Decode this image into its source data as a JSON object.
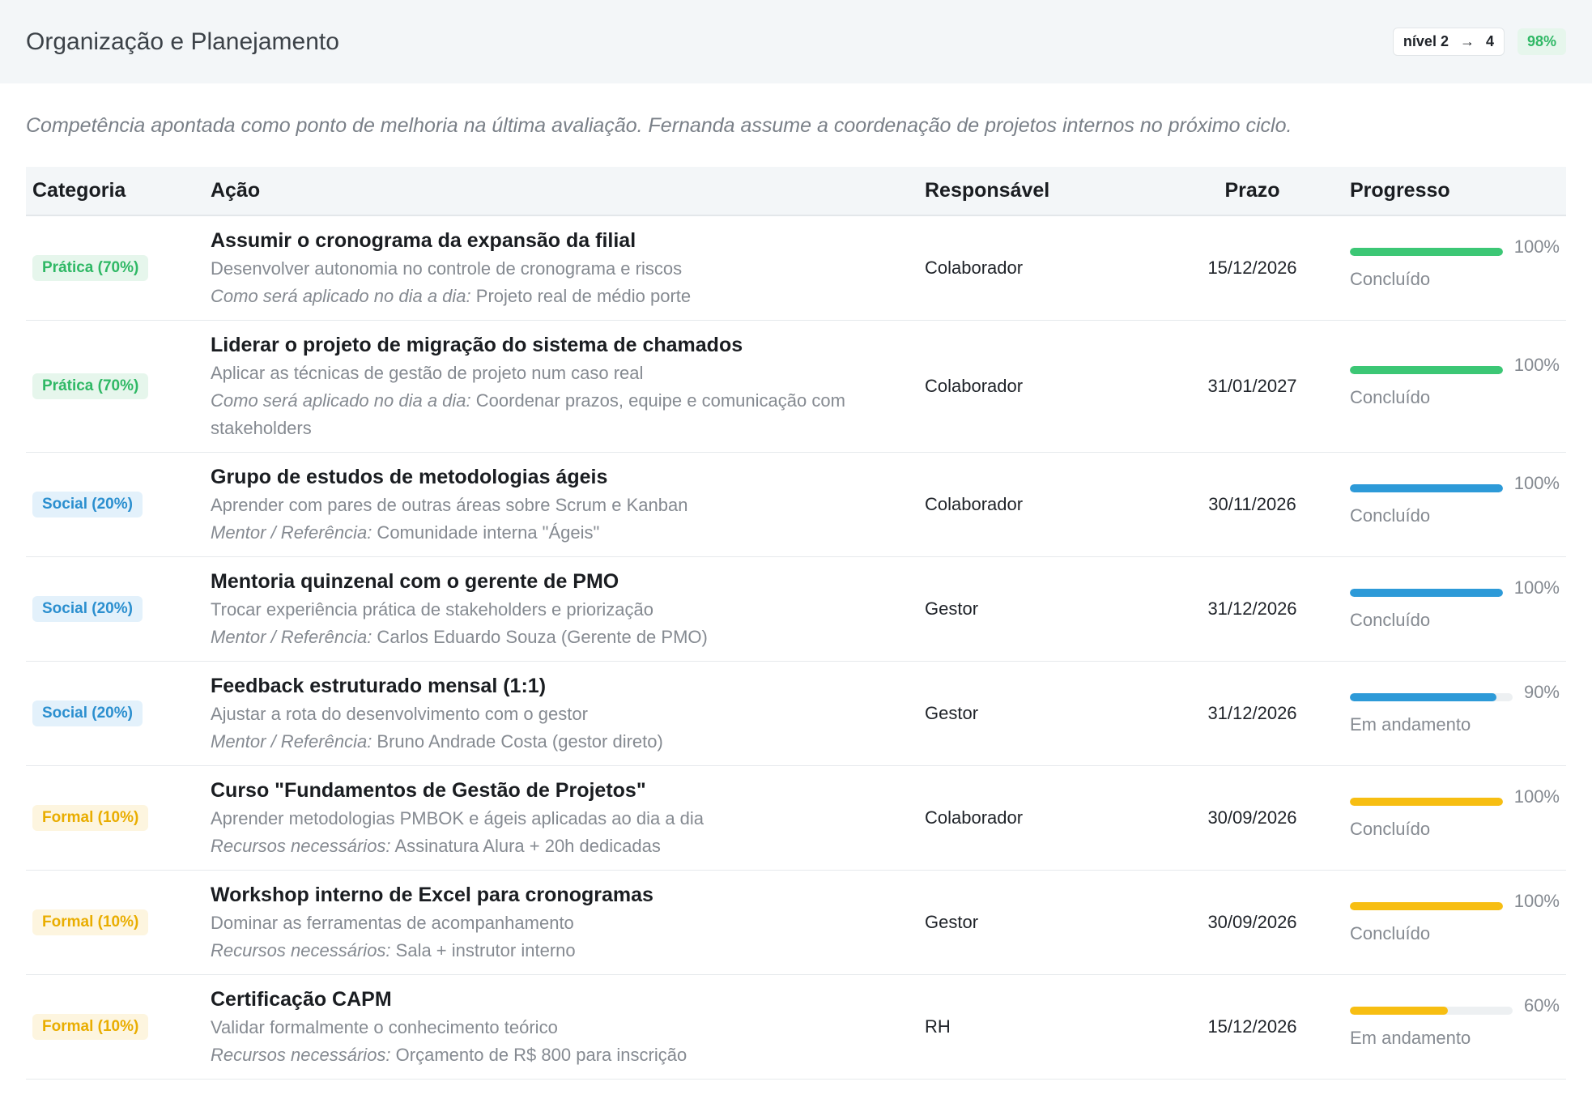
{
  "header": {
    "title": "Organização e Planejamento",
    "level_from": "nível 2",
    "level_arrow": "→",
    "level_to": "4",
    "percent": "98%"
  },
  "note": "Competência apontada como ponto de melhoria na última avaliação. Fernanda assume a coordenação de projetos internos no próximo ciclo.",
  "colors": {
    "pratica": "#3cc775",
    "social": "#2d9ad8",
    "formal": "#f7be12"
  },
  "table": {
    "columns": [
      "Categoria",
      "Ação",
      "Responsável",
      "Prazo",
      "Progresso"
    ],
    "rows": [
      {
        "category": "Prática (70%)",
        "kind": "pratica",
        "title": "Assumir o cronograma da expansão da filial",
        "desc": "Desenvolver autonomia no controle de cronograma e riscos",
        "extra_label": "Como será aplicado no dia a dia:",
        "extra_value": " Projeto real de médio porte",
        "responsible": "Colaborador",
        "deadline": "15/12/2026",
        "progress": 100,
        "progress_label": "100%",
        "status": "Concluído"
      },
      {
        "category": "Prática (70%)",
        "kind": "pratica",
        "title": "Liderar o projeto de migração do sistema de chamados",
        "desc": "Aplicar as técnicas de gestão de projeto num caso real",
        "extra_label": "Como será aplicado no dia a dia:",
        "extra_value": " Coordenar prazos, equipe e comunicação com stakeholders",
        "responsible": "Colaborador",
        "deadline": "31/01/2027",
        "progress": 100,
        "progress_label": "100%",
        "status": "Concluído"
      },
      {
        "category": "Social (20%)",
        "kind": "social",
        "title": "Grupo de estudos de metodologias ágeis",
        "desc": "Aprender com pares de outras áreas sobre Scrum e Kanban",
        "extra_label": "Mentor / Referência:",
        "extra_value": " Comunidade interna \"Ágeis\"",
        "responsible": "Colaborador",
        "deadline": "30/11/2026",
        "progress": 100,
        "progress_label": "100%",
        "status": "Concluído"
      },
      {
        "category": "Social (20%)",
        "kind": "social",
        "title": "Mentoria quinzenal com o gerente de PMO",
        "desc": "Trocar experiência prática de stakeholders e priorização",
        "extra_label": "Mentor / Referência:",
        "extra_value": " Carlos Eduardo Souza (Gerente de PMO)",
        "responsible": "Gestor",
        "deadline": "31/12/2026",
        "progress": 100,
        "progress_label": "100%",
        "status": "Concluído"
      },
      {
        "category": "Social (20%)",
        "kind": "social",
        "title": "Feedback estruturado mensal (1:1)",
        "desc": "Ajustar a rota do desenvolvimento com o gestor",
        "extra_label": "Mentor / Referência:",
        "extra_value": " Bruno Andrade Costa (gestor direto)",
        "responsible": "Gestor",
        "deadline": "31/12/2026",
        "progress": 90,
        "progress_label": "90%",
        "status": "Em andamento"
      },
      {
        "category": "Formal (10%)",
        "kind": "formal",
        "title": "Curso \"Fundamentos de Gestão de Projetos\"",
        "desc": "Aprender metodologias PMBOK e ágeis aplicadas ao dia a dia",
        "extra_label": "Recursos necessários:",
        "extra_value": " Assinatura Alura + 20h dedicadas",
        "responsible": "Colaborador",
        "deadline": "30/09/2026",
        "progress": 100,
        "progress_label": "100%",
        "status": "Concluído"
      },
      {
        "category": "Formal (10%)",
        "kind": "formal",
        "title": "Workshop interno de Excel para cronogramas",
        "desc": "Dominar as ferramentas de acompanhamento",
        "extra_label": "Recursos necessários:",
        "extra_value": " Sala + instrutor interno",
        "responsible": "Gestor",
        "deadline": "30/09/2026",
        "progress": 100,
        "progress_label": "100%",
        "status": "Concluído"
      },
      {
        "category": "Formal (10%)",
        "kind": "formal",
        "title": "Certificação CAPM",
        "desc": "Validar formalmente o conhecimento teórico",
        "extra_label": "Recursos necessários:",
        "extra_value": " Orçamento de R$ 800 para inscrição",
        "responsible": "RH",
        "deadline": "15/12/2026",
        "progress": 60,
        "progress_label": "60%",
        "status": "Em andamento"
      }
    ]
  }
}
